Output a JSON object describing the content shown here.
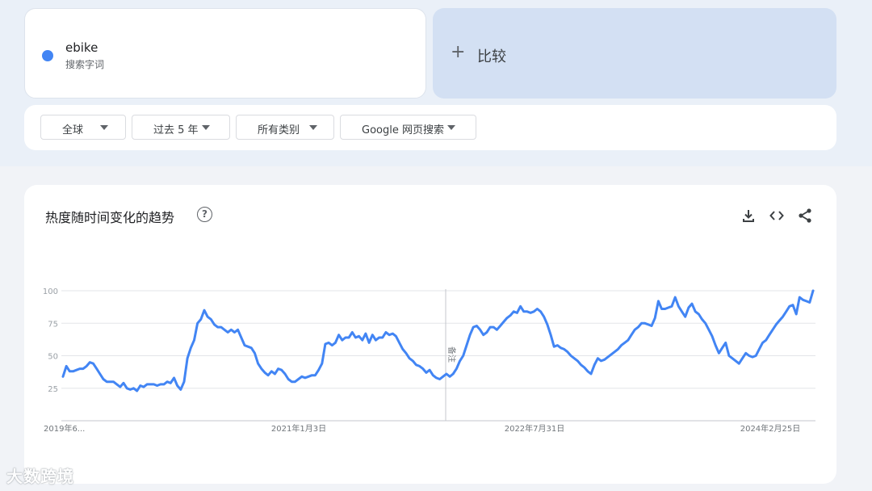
{
  "search_term": {
    "name": "ebike",
    "type": "搜索字词",
    "color": "#4285f4"
  },
  "compare": {
    "label": "比较"
  },
  "filters": [
    {
      "label": "全球"
    },
    {
      "label": "过去 5 年"
    },
    {
      "label": "所有类别"
    },
    {
      "label": "Google 网页搜索"
    }
  ],
  "chart_section": {
    "title": "热度随时间变化的趋势",
    "help_icon": "help-circle-icon",
    "tools": [
      "download-icon",
      "embed-code-icon",
      "share-icon"
    ]
  },
  "chart_data": {
    "type": "line",
    "yticks": [
      "100",
      "75",
      "50",
      "25"
    ],
    "ylim": [
      0,
      100
    ],
    "xlabels": [
      "2019年6...",
      "2021年1月3日",
      "2022年7月31日",
      "2024年2月25日"
    ],
    "annotation": "备注",
    "grid": true,
    "series": [
      {
        "color": "#4285f4",
        "values": [
          34,
          42,
          38,
          38,
          39,
          40,
          40,
          42,
          45,
          44,
          40,
          36,
          32,
          30,
          30,
          30,
          28,
          26,
          29,
          25,
          24,
          25,
          23,
          27,
          26,
          28,
          28,
          28,
          27,
          28,
          28,
          30,
          29,
          33,
          27,
          24,
          30,
          48,
          56,
          62,
          75,
          78,
          85,
          80,
          78,
          74,
          72,
          72,
          70,
          68,
          70,
          68,
          70,
          64,
          58,
          57,
          56,
          52,
          44,
          40,
          37,
          35,
          38,
          36,
          40,
          39,
          36,
          32,
          30,
          30,
          32,
          34,
          33,
          34,
          35,
          35,
          39,
          44,
          59,
          60,
          58,
          60,
          66,
          62,
          64,
          64,
          68,
          64,
          65,
          62,
          67,
          60,
          66,
          62,
          64,
          64,
          68,
          66,
          67,
          65,
          60,
          55,
          52,
          48,
          46,
          43,
          42,
          40,
          37,
          39,
          35,
          33,
          32,
          34,
          36,
          34,
          36,
          40,
          46,
          50,
          58,
          66,
          72,
          73,
          70,
          66,
          68,
          72,
          72,
          70,
          73,
          76,
          79,
          81,
          84,
          83,
          88,
          84,
          84,
          83,
          84,
          86,
          84,
          80,
          74,
          66,
          57,
          58,
          56,
          55,
          53,
          50,
          48,
          46,
          43,
          41,
          38,
          36,
          43,
          48,
          46,
          47,
          49,
          51,
          53,
          55,
          58,
          60,
          62,
          66,
          70,
          72,
          75,
          75,
          74,
          73,
          79,
          92,
          86,
          86,
          87,
          88,
          95,
          88,
          84,
          80,
          87,
          90,
          84,
          82,
          78,
          75,
          70,
          65,
          58,
          52,
          56,
          60,
          50,
          48,
          46,
          44,
          48,
          52,
          50,
          49,
          50,
          55,
          60,
          62,
          66,
          70,
          74,
          77,
          80,
          84,
          88,
          89,
          82,
          95,
          93,
          92,
          91,
          100
        ]
      }
    ]
  }
}
